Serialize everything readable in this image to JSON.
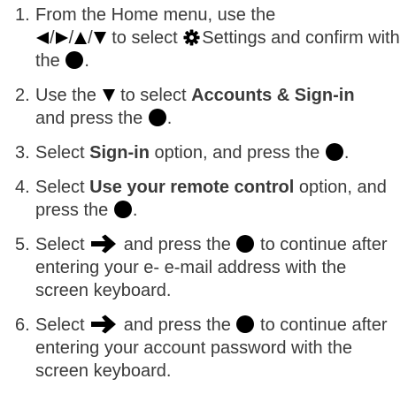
{
  "steps": [
    {
      "number": "1.",
      "parts": {
        "a": "From the Home menu, use the",
        "slash1": "/",
        "slash2": "/",
        "slash3": "/",
        "b": "to select",
        "c": "Settings and confirm with the",
        "d": "."
      }
    },
    {
      "number": "2.",
      "parts": {
        "a": "Use the",
        "b": "to select",
        "bold": "Accounts & Sign-in",
        "c": "and press the",
        "d": "."
      }
    },
    {
      "number": "3.",
      "parts": {
        "a": "Select",
        "bold": "Sign-in",
        "b": "option, and press the",
        "c": "."
      }
    },
    {
      "number": "4.",
      "parts": {
        "a": "Select",
        "bold": "Use your remote control",
        "b": "option, and press the",
        "c": "."
      }
    },
    {
      "number": "5.",
      "parts": {
        "a": "Select",
        "b": "and press the",
        "c": "to continue after entering your e- e-mail address with the screen keyboard."
      }
    },
    {
      "number": "6.",
      "parts": {
        "a": "Select",
        "b": "and press the",
        "c": "to continue after entering your account password with the screen keyboard."
      }
    }
  ],
  "icons": {
    "left": "left-triangle-icon",
    "right": "right-triangle-icon",
    "up": "up-triangle-icon",
    "down": "down-triangle-icon",
    "settings": "gear-icon",
    "ok": "ok-button-dot-icon",
    "next": "right-arrow-icon",
    "icon_color": "#000000",
    "text_color": "#3a3a3a"
  }
}
